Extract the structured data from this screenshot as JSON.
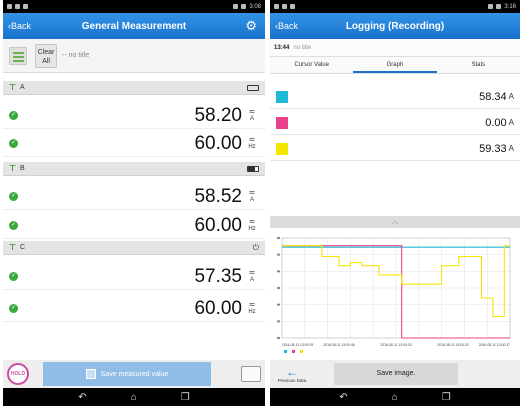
{
  "left": {
    "statusbar": {
      "time": "3:08"
    },
    "header": {
      "back_label": "Back",
      "title": "General Measurement",
      "settings_icon": "gear-icon"
    },
    "titlebar": {
      "clear_label_line1": "Clear",
      "clear_label_line2": "All",
      "title_placeholder": "--  no title"
    },
    "groups": [
      {
        "name": "A",
        "battery_icon": "battery-empty-icon",
        "readings": [
          {
            "value": "58.20",
            "unit": "A",
            "wave": "≂"
          },
          {
            "value": "60.00",
            "unit": "Hz",
            "wave": "≂"
          }
        ]
      },
      {
        "name": "B",
        "battery_icon": "battery-full-icon",
        "readings": [
          {
            "value": "58.52",
            "unit": "A",
            "wave": "≂"
          },
          {
            "value": "60.00",
            "unit": "Hz",
            "wave": "≂"
          }
        ]
      },
      {
        "name": "C",
        "battery_icon": "plug-icon",
        "readings": [
          {
            "value": "57.35",
            "unit": "A",
            "wave": "≂"
          },
          {
            "value": "60.00",
            "unit": "Hz",
            "wave": "≂"
          }
        ]
      }
    ],
    "bottom": {
      "hold_label": "HOLD",
      "save_label": "Save measured value"
    }
  },
  "right": {
    "statusbar": {
      "time": "3:16"
    },
    "header": {
      "back_label": "Back",
      "title": "Logging (Recording)"
    },
    "title_row": {
      "time": "13:44",
      "placeholder": "no title"
    },
    "tabs": [
      "Cursor Value",
      "Graph",
      "Stats"
    ],
    "active_tab": "Graph",
    "cursor_values": [
      {
        "color": "#1fb8d6",
        "value": "58.34",
        "unit": "A"
      },
      {
        "color": "#e8418a",
        "value": "0.00",
        "unit": "A"
      },
      {
        "color": "#f2e600",
        "value": "59.33",
        "unit": "A"
      }
    ],
    "bottom": {
      "prev_label": "Previous Data",
      "save_image_label": "Save image."
    }
  },
  "chart_data": {
    "type": "line",
    "x": [
      "2016-08-11 13:00:29",
      "2016-08-11 13:00:46",
      "2016-08-11 13:00:03",
      "2016-08-11 13:00:20",
      "2016-08-11 13:00:37"
    ],
    "ylim": [
      0,
      65
    ],
    "grid": true,
    "series": [
      {
        "color": "#1fb8d6",
        "values": [
          59,
          59,
          59,
          59,
          59,
          59,
          59,
          59,
          59,
          59,
          59,
          59,
          59,
          59,
          59,
          59,
          59,
          59,
          59,
          59,
          59,
          59,
          59,
          59,
          59,
          59,
          59,
          59,
          59,
          59,
          59,
          59,
          59,
          59,
          59,
          59,
          59,
          59,
          59,
          59,
          59
        ]
      },
      {
        "color": "#e8418a",
        "values": [
          60,
          60,
          60,
          60,
          60,
          60,
          60,
          60,
          60,
          60,
          60,
          60,
          60,
          60,
          60,
          60,
          60,
          60,
          60,
          60,
          60,
          0,
          0,
          0,
          0,
          0,
          0,
          0,
          0,
          0,
          0,
          0,
          0,
          0,
          0,
          0,
          0,
          0,
          0,
          0,
          0
        ]
      },
      {
        "color": "#f2e600",
        "values": [
          60,
          60,
          60,
          60,
          60,
          60,
          60,
          53,
          53,
          53,
          47,
          47,
          49,
          49,
          47,
          47,
          47,
          41,
          41,
          41,
          41,
          35,
          35,
          35,
          35,
          35,
          35,
          35,
          47,
          47,
          47,
          53,
          53,
          53,
          53,
          26,
          26,
          14,
          14,
          60,
          60
        ]
      }
    ]
  }
}
